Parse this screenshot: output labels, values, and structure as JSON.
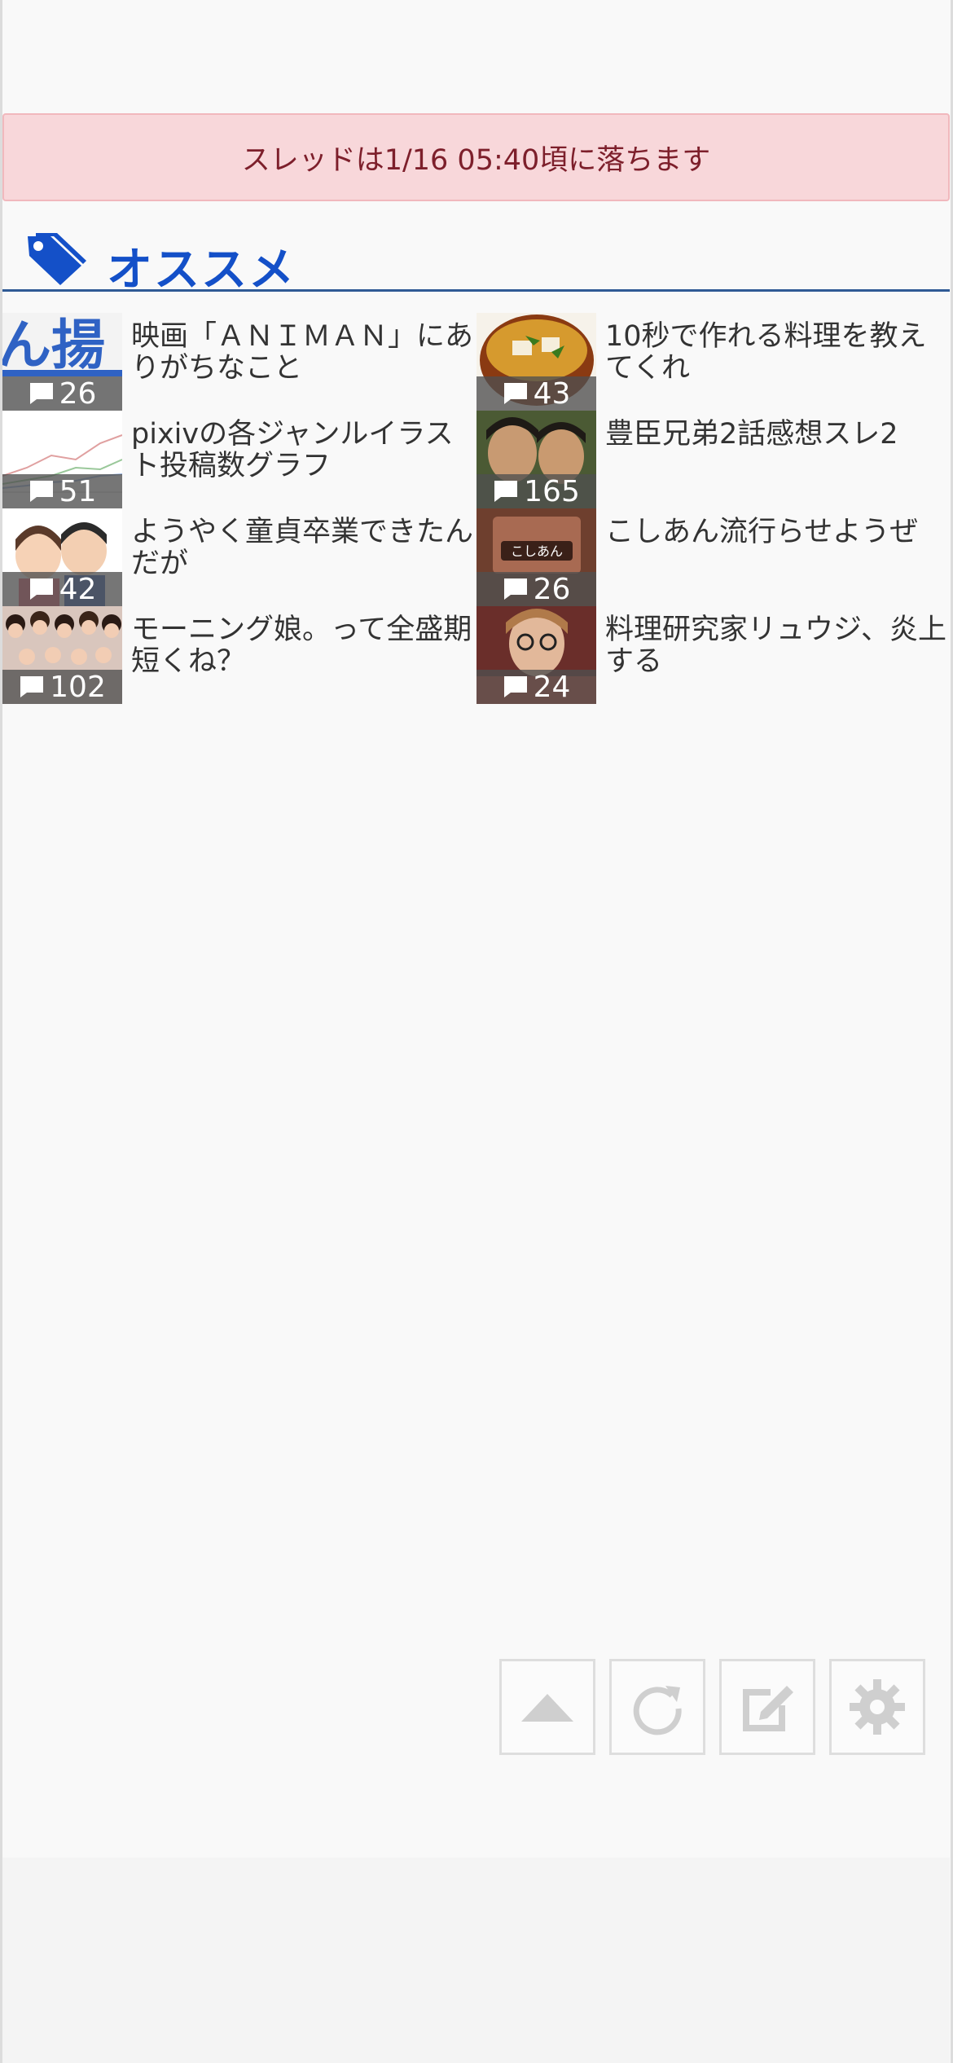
{
  "notice": {
    "text": "スレッドは1/16 05:40頃に落ちます"
  },
  "recommend": {
    "title": "オススメ",
    "items": [
      {
        "title": "映画「ＡＮＩＭＡＮ」にありがちなこと",
        "count": "26"
      },
      {
        "title": "10秒で作れる料理を教えてくれ",
        "count": "43"
      },
      {
        "title": "pixivの各ジャンルイラスト投稿数グラフ",
        "count": "51"
      },
      {
        "title": "豊臣兄弟2話感想スレ2",
        "count": "165"
      },
      {
        "title": "ようやく童貞卒業できたんだが",
        "count": "42"
      },
      {
        "title": "こしあん流行らせようぜ",
        "count": "26"
      },
      {
        "title": "モーニング娘。って全盛期短くね？",
        "count": "102"
      },
      {
        "title": "料理研究家リュウジ、炎上する",
        "count": "24"
      }
    ]
  },
  "thumb_text": {
    "koshian": "こしあん",
    "katakana": "ん揚"
  },
  "toolbar": [
    "scroll-top-icon",
    "reload-icon",
    "compose-icon",
    "settings-icon"
  ],
  "colors": {
    "accent": "#1450c8",
    "notice_bg": "#f8d7da",
    "notice_text": "#7d1f2b",
    "divider": "#2f5a95"
  }
}
